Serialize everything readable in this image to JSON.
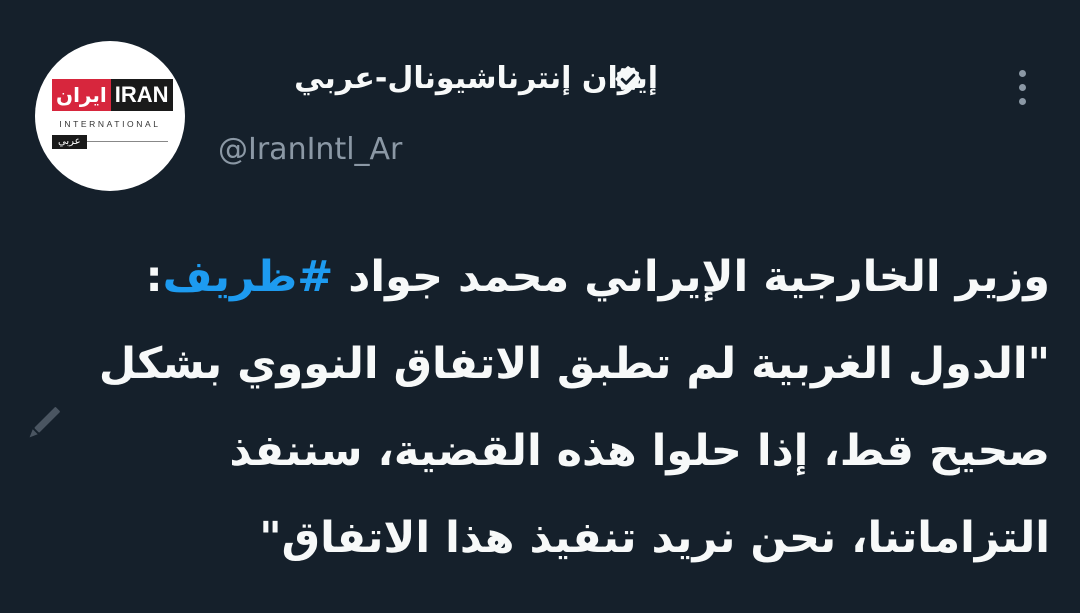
{
  "account": {
    "display_name": "إيران إنترناشيونال-عربي",
    "handle": "@IranIntl_Ar",
    "verified_icon": "verified-badge-icon",
    "avatar": {
      "logo_arabic": "ايران",
      "logo_latin": "IRAN",
      "logo_tagline": "INTERNATIONAL",
      "logo_sub": "عربي",
      "colors": {
        "red": "#d7263d",
        "black": "#1a1a1a",
        "background": "#ffffff"
      }
    }
  },
  "tweet": {
    "line_1_prefix": "وزير الخارجية الإيراني محمد جواد ",
    "hashtag": "#ظريف",
    "line_1_suffix": ":",
    "quote": "\"الدول الغربية لم تطبق الاتفاق النووي بشكل صحيح قط، إذا حلوا هذه القضية، سننفذ التزاماتنا، نحن نريد تنفيذ هذا الاتفاق\""
  },
  "icons": {
    "more": "more-options-icon",
    "compose": "pencil-icon"
  },
  "colors": {
    "background": "#15202b",
    "text": "#f7f9f9",
    "muted": "#8b98a5",
    "link": "#1d9bf0"
  }
}
